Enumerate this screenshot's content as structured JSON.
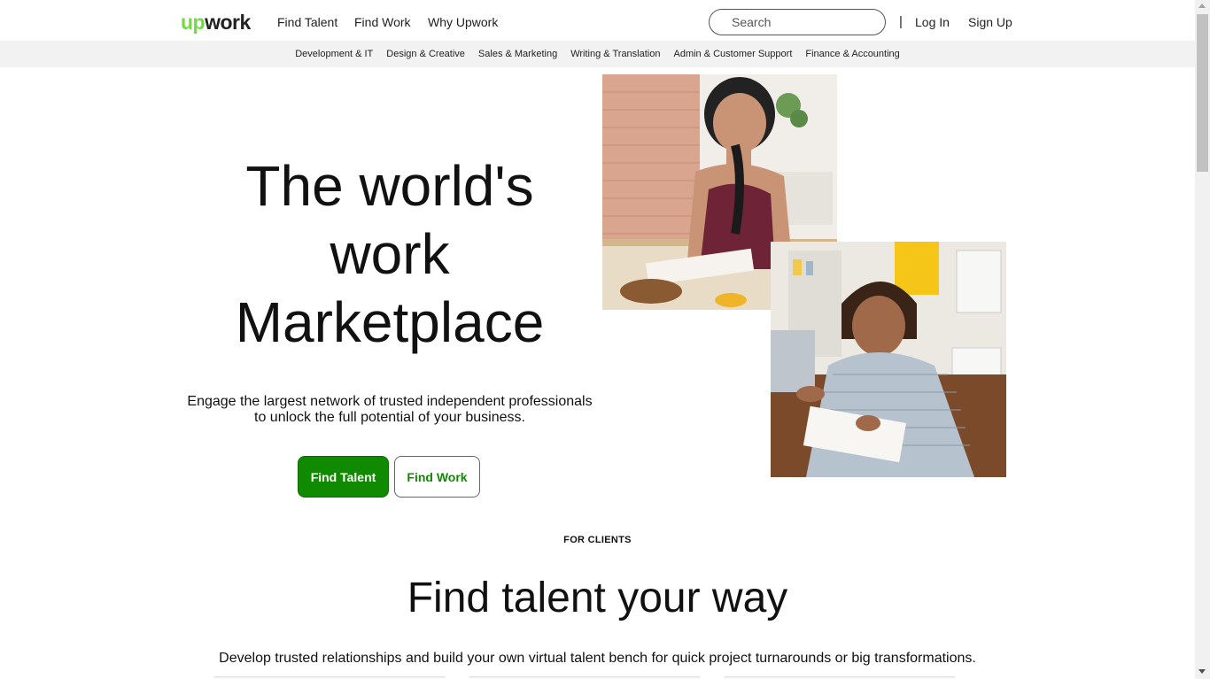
{
  "header": {
    "logo_up": "up",
    "logo_work": "work",
    "nav": [
      "Find Talent",
      "Find Work",
      "Why Upwork"
    ],
    "search_placeholder": "Search",
    "divider": "|",
    "login": "Log In",
    "signup": "Sign Up"
  },
  "categories": [
    "Development & IT",
    "Design & Creative",
    "Sales & Marketing",
    "Writing & Translation",
    "Admin & Customer Support",
    "Finance & Accounting"
  ],
  "hero": {
    "title_lines": [
      "The world's",
      "work",
      "Marketplace"
    ],
    "subtitle_lines": [
      "Engage the largest network of trusted independent professionals",
      "to unlock the full potential of your business."
    ],
    "btn_find_talent": "Find Talent",
    "btn_find_work": "Find Work"
  },
  "clients": {
    "eyebrow": "FOR CLIENTS",
    "title": "Find talent your way",
    "subtitle": "Develop trusted relationships and build your own virtual talent bench for quick project turnarounds or big transformations."
  },
  "colors": {
    "brand_green": "#108a00",
    "logo_green": "#6fda44"
  }
}
